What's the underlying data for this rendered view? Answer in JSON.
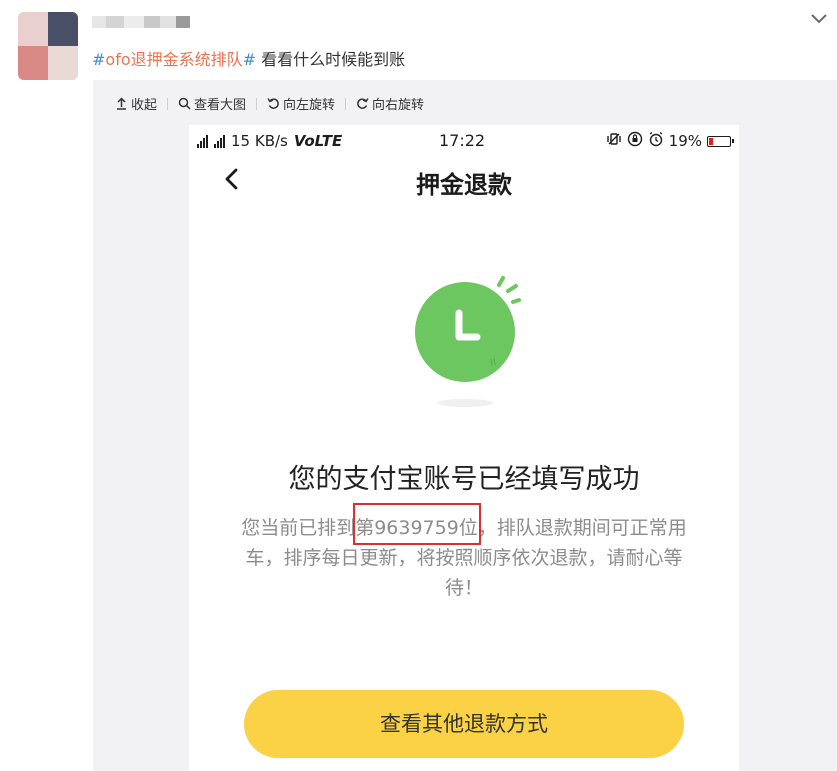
{
  "post": {
    "hashtag_hash": "#",
    "hashtag_text": "ofo退押金系统排队",
    "hashtag_hash_end": "#",
    "text": " 看看什么时候能到账"
  },
  "toolbar": {
    "collapse": "收起",
    "view_large": "查看大图",
    "rotate_left": "向左旋转",
    "rotate_right": "向右旋转"
  },
  "statusbar": {
    "speed": "15 KB/s",
    "volte": "VoLTE",
    "time": "17:22",
    "battery": "19%",
    "battery_level": 0.19
  },
  "screen": {
    "title": "押金退款",
    "headline": "您的支付宝账号已经填写成功",
    "desc_line1": "您当前已排到第9639759位，排队退款期间可正常用",
    "desc_line2": "车，排序每日更新，将按照顺序依次退款，请耐心等",
    "desc_line3": "待！",
    "button": "查看其他退款方式"
  },
  "colors": {
    "accent_yellow": "#fbd145",
    "clock_green": "#6cc760",
    "highlight_red": "#d93030",
    "hashtag_orange": "#eb7350",
    "hash_blue": "#3f8fd6"
  }
}
